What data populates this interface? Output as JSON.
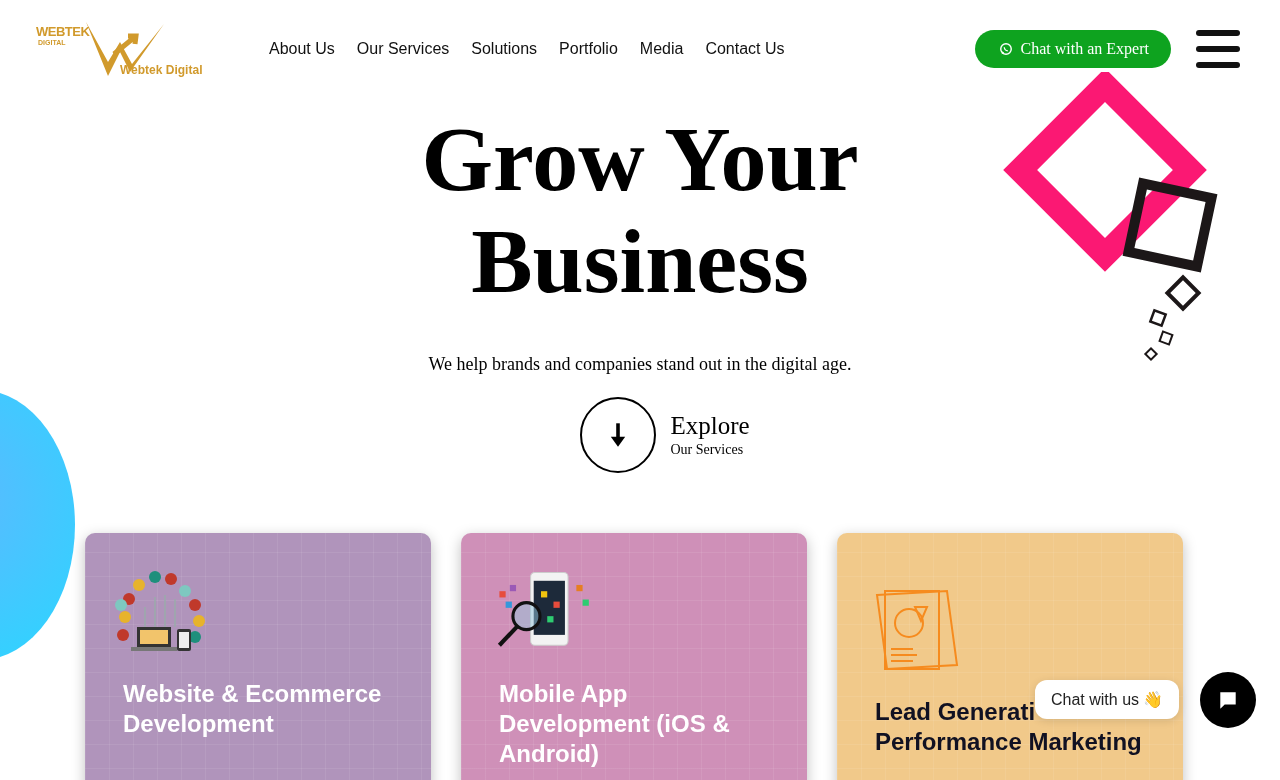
{
  "logo": {
    "badge_top": "WEBTEK",
    "badge_bottom": "DIGITAL",
    "wordmark": "Webtek Digital"
  },
  "nav": [
    "About Us",
    "Our Services",
    "Solutions",
    "Portfolio",
    "Media",
    "Contact Us"
  ],
  "cta": {
    "label": "Chat with an Expert"
  },
  "hero": {
    "title_lines": [
      "Grow Your",
      "Business"
    ],
    "subtitle": "We help brands and companies stand out in the digital age.",
    "explore": {
      "label": "Explore",
      "sublabel": "Our Services"
    }
  },
  "cards": [
    {
      "kind": "web",
      "color": "#b094bb",
      "title_lines": [
        "Website & Ecommerce",
        "Development"
      ]
    },
    {
      "kind": "mobile",
      "color": "#cf90b8",
      "title_lines": [
        "Mobile App",
        "Development (iOS &",
        "Android)"
      ]
    },
    {
      "kind": "report",
      "color": "#f1c98a",
      "title_lines": [
        "Lead Generati",
        "Performance Marketing"
      ]
    }
  ],
  "chat_widget": {
    "label": "Chat with us",
    "emoji": "👋"
  }
}
